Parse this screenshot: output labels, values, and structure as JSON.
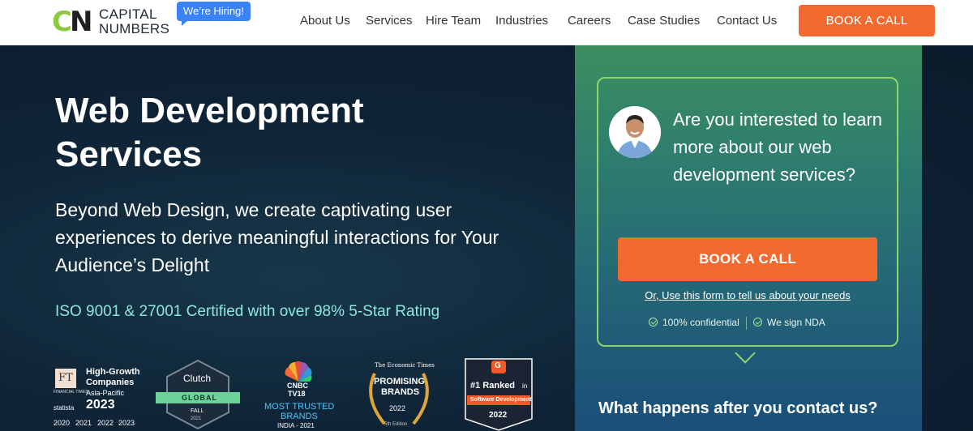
{
  "header": {
    "logo_top": "CAPITAL",
    "logo_bottom": "NUMBERS",
    "hiring_badge": "We’re Hiring!",
    "nav": [
      "About Us",
      "Services",
      "Hire Team",
      "Industries",
      "Careers",
      "Case Studies",
      "Contact Us"
    ],
    "cta": "BOOK A CALL"
  },
  "hero": {
    "title_line1": "Web Development",
    "title_line2": "Services",
    "subtitle": "Beyond Web Design, we create captivating user experiences to derive meaningful interactions for Your Audience’s Delight",
    "certification": "ISO 9001 & 27001 Certified with over 98% 5-Star Rating"
  },
  "badges": {
    "ft": {
      "mark": "FT",
      "small": "FINANCIAL TIMES",
      "title1": "High-Growth",
      "title2": "Companies",
      "region": "Asia-Pacific",
      "year": "2023",
      "statista": "statista",
      "years": [
        "2020",
        "2021",
        "2022",
        "2023"
      ]
    },
    "clutch": {
      "name": "Clutch",
      "ribbon": "GLOBAL",
      "season": "FALL",
      "year": "2021"
    },
    "cnbc": {
      "name": "CNBC",
      "sub": "TV18",
      "line1": "MOST TRUSTED",
      "line2": "BRANDS",
      "line3": "INDIA - 2021"
    },
    "et": {
      "top": "The Economic Times",
      "line1": "PROMISING",
      "line2": "BRANDS",
      "year": "2022",
      "edition": "5th Edition"
    },
    "g2": {
      "rank": "#1 Ranked",
      "rank_suffix": "in",
      "category": "Software Development",
      "year": "2022"
    }
  },
  "panel": {
    "question": "Are you interested to learn more about our web development services?",
    "cta": "BOOK A CALL",
    "link": "Or, Use this form to tell us about your needs",
    "guarantees": [
      "100% confidential",
      "We sign NDA"
    ],
    "next_heading": "What happens after you contact us?"
  },
  "colors": {
    "accent_orange": "#f26a2e",
    "logo_green": "#8dc63f",
    "hiring_blue": "#3b82f6",
    "cert_cyan": "#8ee6e0",
    "frame_green": "#8fd66a"
  }
}
